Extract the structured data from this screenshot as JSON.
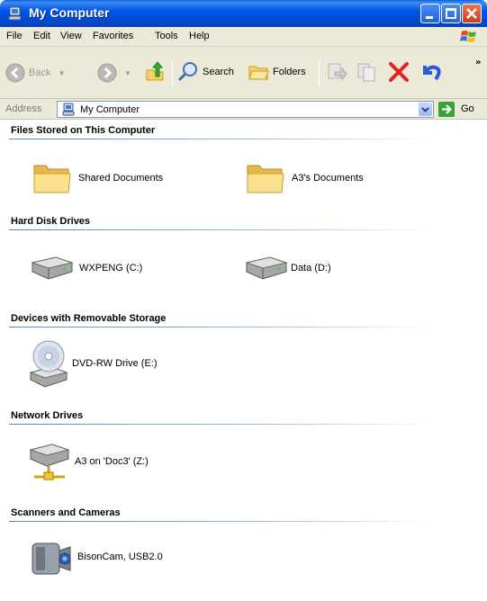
{
  "window": {
    "title": "My Computer"
  },
  "menu": [
    "File",
    "Edit",
    "View",
    "Favorites",
    "Tools",
    "Help"
  ],
  "toolbar": {
    "back_label": "Back",
    "search_label": "Search",
    "folders_label": "Folders",
    "overflow_glyph": "»"
  },
  "address": {
    "label": "Address",
    "value": "My Computer",
    "go_label": "Go"
  },
  "groups": [
    {
      "title": "Files Stored on This Computer",
      "items": [
        {
          "label": "Shared Documents",
          "icon": "folder-icon"
        },
        {
          "label": "A3's Documents",
          "icon": "folder-icon"
        }
      ]
    },
    {
      "title": "Hard Disk Drives",
      "items": [
        {
          "label": "WXPENG (C:)",
          "icon": "hard-drive-icon"
        },
        {
          "label": "Data (D:)",
          "icon": "hard-drive-icon"
        }
      ]
    },
    {
      "title": "Devices with Removable Storage",
      "items": [
        {
          "label": "DVD-RW Drive (E:)",
          "icon": "dvd-drive-icon"
        }
      ]
    },
    {
      "title": "Network Drives",
      "items": [
        {
          "label": "A3 on 'Doc3' (Z:)",
          "icon": "network-drive-icon"
        }
      ]
    },
    {
      "title": "Scanners and Cameras",
      "items": [
        {
          "label": "BisonCam, USB2.0",
          "icon": "camera-icon"
        }
      ]
    }
  ]
}
